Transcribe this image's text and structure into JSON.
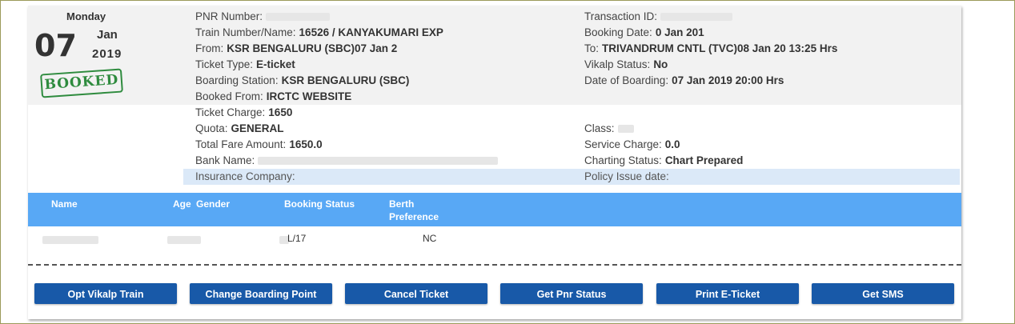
{
  "date": {
    "weekday": "Monday",
    "day": "07",
    "month": "Jan",
    "year": "2019",
    "status_stamp": "BOOKED"
  },
  "left_details": [
    {
      "label": "PNR Number:",
      "value": ""
    },
    {
      "label": "Train Number/Name:",
      "value": "16526 / KANYAKUMARI EXP"
    },
    {
      "label": "From:",
      "value": "KSR BENGALURU (SBC)07 Jan 2"
    },
    {
      "label": "Ticket Type:",
      "value": "E-ticket"
    },
    {
      "label": "Boarding Station:",
      "value": "KSR BENGALURU (SBC)"
    },
    {
      "label": "Booked From:",
      "value": "IRCTC WEBSITE"
    },
    {
      "label": "Ticket Charge:",
      "value": "1650"
    },
    {
      "label": "Quota:",
      "value": "GENERAL"
    },
    {
      "label": "Total Fare Amount:",
      "value": "1650.0"
    },
    {
      "label": "Bank Name:",
      "value": ""
    }
  ],
  "right_details": [
    {
      "label": "Transaction ID:",
      "value": ""
    },
    {
      "label": "Booking Date:",
      "value": "0 Jan 201"
    },
    {
      "label": "To:",
      "value": "TRIVANDRUM CNTL (TVC)08 Jan 20 13:25 Hrs"
    },
    {
      "label": "Vikalp Status:",
      "value": "No"
    },
    {
      "label": "Date of Boarding:",
      "value": "07 Jan 2019 20:00 Hrs"
    },
    {
      "label": "Class:",
      "value": ""
    },
    {
      "label": "Service Charge:",
      "value": "0.0"
    },
    {
      "label": "Charting Status:",
      "value": "Chart Prepared"
    }
  ],
  "insurance": {
    "company_label": "Insurance Company:",
    "policy_label": "Policy Issue date:"
  },
  "passenger_table": {
    "headers": [
      "Name",
      "Age",
      "Gender",
      "Booking Status",
      "Berth",
      "Preference"
    ],
    "row": {
      "booking_status": "L/17",
      "berth_preference": "NC"
    }
  },
  "actions": [
    "Opt Vikalp Train",
    "Change Boarding Point",
    "Cancel Ticket",
    "Get Pnr Status",
    "Print E-Ticket",
    "Get SMS"
  ],
  "colors": {
    "header_blue": "#58a8f5",
    "button_blue": "#1859a8",
    "stamp_green": "#2e8b3e",
    "insurance_bar": "#dbe9f8"
  }
}
